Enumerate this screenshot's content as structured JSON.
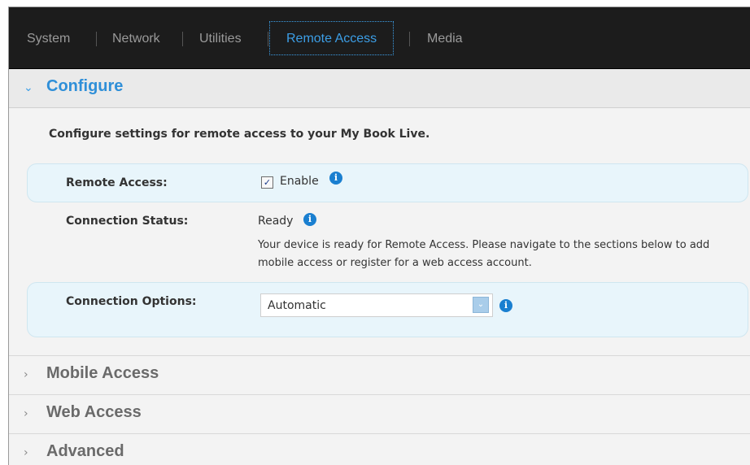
{
  "nav": {
    "tabs": [
      {
        "label": "System"
      },
      {
        "label": "Network"
      },
      {
        "label": "Utilities"
      },
      {
        "label": "Remote Access",
        "active": true
      },
      {
        "label": "Media"
      }
    ]
  },
  "sections": {
    "configure": {
      "title": "Configure",
      "expanded": true
    },
    "mobile": {
      "title": "Mobile Access",
      "expanded": false
    },
    "web": {
      "title": "Web Access",
      "expanded": false
    },
    "advanced": {
      "title": "Advanced",
      "expanded": false
    }
  },
  "configure": {
    "intro": "Configure settings for remote access to your My Book Live.",
    "remote_access": {
      "label": "Remote Access:",
      "checkbox_label": "Enable",
      "checked": true
    },
    "connection_status": {
      "label": "Connection Status:",
      "value": "Ready",
      "description": "Your device is ready for Remote Access. Please navigate to the sections below to add mobile access or register for a web access account."
    },
    "connection_options": {
      "label": "Connection Options:",
      "selected": "Automatic"
    }
  },
  "icons": {
    "info": "i",
    "checkmark": "✓",
    "chevron_down": "⌄",
    "chevron_right": "›"
  },
  "colors": {
    "accent": "#2f8fd8",
    "nav_bg": "#1c1c1c",
    "row_highlight": "#e8f5fb"
  }
}
